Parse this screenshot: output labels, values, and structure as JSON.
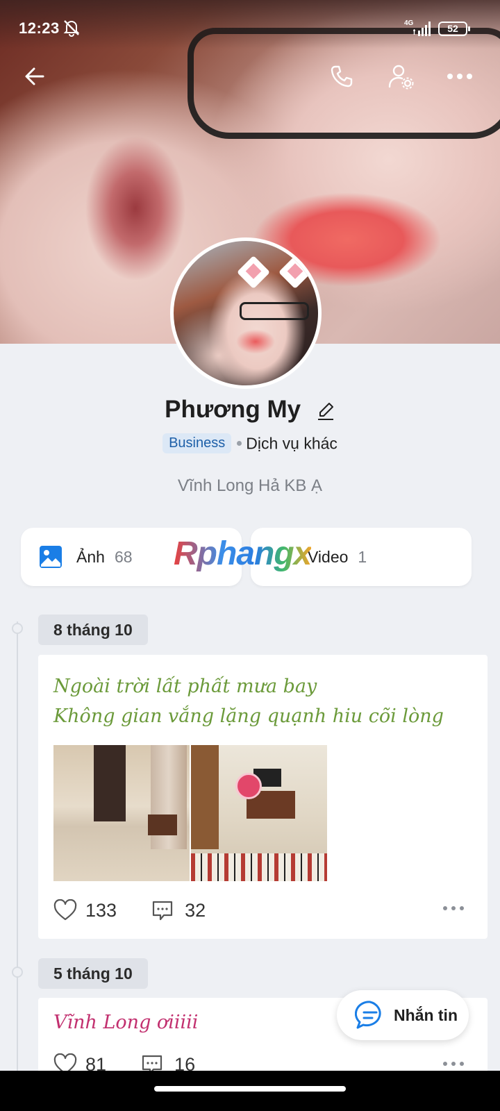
{
  "status_bar": {
    "time": "12:23",
    "network": "4G",
    "battery": "52"
  },
  "profile": {
    "name": "Phương My",
    "badge": "Business",
    "category": "Dịch vụ khác",
    "bio": "Vĩnh Long Hả KB Ạ"
  },
  "media": {
    "photos": {
      "label": "Ảnh",
      "count": "68"
    },
    "videos": {
      "label": "Video",
      "count": "1"
    }
  },
  "watermark": "Rphangx",
  "posts": [
    {
      "date": "8 tháng 10",
      "lines": [
        "Ngoài trời lất phất mưa bay",
        "Không gian vắng lặng quạnh hiu cõi lòng"
      ],
      "likes": "133",
      "comments": "32"
    },
    {
      "date": "5 tháng 10",
      "text": "Vĩnh Long ơiiiii",
      "likes": "81",
      "comments": "16"
    }
  ],
  "message_button": {
    "label": "Nhắn tin"
  },
  "colors": {
    "accent": "#1d5fa8",
    "badge_bg": "#dce8f6",
    "poem_green": "#6b9a3a",
    "post_pink": "#c2306f",
    "photo_icon": "#1a7ee6"
  }
}
